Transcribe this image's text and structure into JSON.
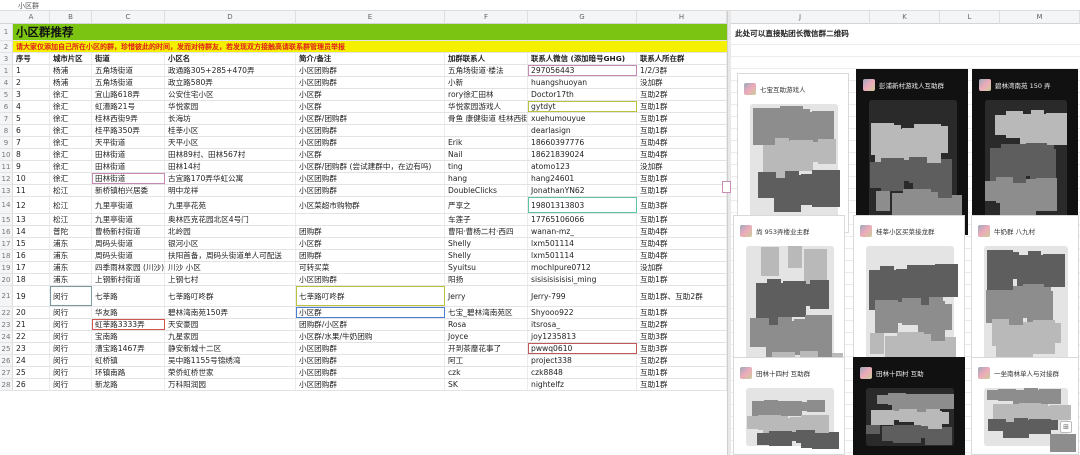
{
  "formula_bar": {
    "cell_text": "小区群"
  },
  "columns": [
    {
      "letter": "A"
    },
    {
      "letter": "B"
    },
    {
      "letter": "C"
    },
    {
      "letter": "D"
    },
    {
      "letter": "E"
    },
    {
      "letter": "F"
    },
    {
      "letter": "G"
    },
    {
      "letter": "H"
    },
    {
      "letter": "I"
    },
    {
      "letter": "J"
    },
    {
      "letter": "K"
    },
    {
      "letter": "L"
    },
    {
      "letter": "M"
    }
  ],
  "sheet": {
    "title": "小区群推荐",
    "notice": "请大家仅添加自己所在小区的群，珍惜彼此的时间，发而对待群友，若发现双方接触高请联系群管理员举报",
    "headers": [
      "序号",
      "城市片区",
      "街道",
      "小区名",
      "简介/备注",
      "加群联系人",
      "联系人微信 (添加暗号GHG)",
      "联系人所在群"
    ],
    "rows": [
      {
        "n": "1",
        "cells": [
          "1",
          "杨浦",
          "五角场街道",
          "政通路305+285+470弄",
          "小区团购群",
          "五角场街道·楼法",
          "297056443",
          "1/2/3群"
        ]
      },
      {
        "n": "4",
        "cells": [
          "2",
          "杨浦",
          "五角场街道",
          "政立路580弄",
          "小区团购群",
          "小新",
          "huangshuoyan",
          "没加群"
        ]
      },
      {
        "n": "5",
        "cells": [
          "3",
          "徐汇",
          "宜山路618弄",
          "公安住宅小区",
          "小区群",
          "rory徐汇田林",
          "Doctor17th",
          "互助2群"
        ]
      },
      {
        "n": "6",
        "cells": [
          "4",
          "徐汇",
          "虹漕路21号",
          "华悦家园",
          "小区群",
          "华悦家园游戏人",
          "gytdyt",
          "互助1群"
        ]
      },
      {
        "n": "7",
        "cells": [
          "5",
          "徐汇",
          "桂林西街9弄",
          "长海坊",
          "小区群/团购群",
          "骨鱼 康健街道 桂林西街",
          "xuehumouyue",
          "互助1群"
        ]
      },
      {
        "n": "8",
        "cells": [
          "6",
          "徐汇",
          "桂平路350弄",
          "桂莘小区",
          "小区团购群",
          "",
          "dearlasign",
          "互助1群"
        ]
      },
      {
        "n": "9",
        "cells": [
          "7",
          "徐汇",
          "天平街道",
          "天平小区",
          "小区团购群",
          "Erik",
          "18660397776",
          "互助4群"
        ]
      },
      {
        "n": "10",
        "cells": [
          "8",
          "徐汇",
          "田林街道",
          "田林89村、田林567村",
          "小区群",
          "Nail",
          "18621839024",
          "互助4群"
        ]
      },
      {
        "n": "11",
        "cells": [
          "9",
          "徐汇",
          "田林街道",
          "田林14村",
          "小区群/团购群 (尝试建群中，在边有吗)",
          "ting",
          "atomo123",
          "没加群"
        ]
      },
      {
        "n": "12",
        "cells": [
          "10",
          "徐汇",
          "田林街道",
          "古宜路170弄华虹公寓",
          "小区团购群",
          "hang",
          "hang24601",
          "互助1群"
        ]
      },
      {
        "n": "13",
        "cells": [
          "11",
          "松江",
          "新桥镇柏兴居委",
          "明中龙祥",
          "小区团购群",
          "DoubleClicks",
          "JonathanYN62",
          "互助1群"
        ]
      },
      {
        "n": "14",
        "cells": [
          "12",
          "松江",
          "九里亭街道",
          "九里亭花苑",
          "小区菜超市购物群",
          "严享之",
          "19801313803",
          "互助3群"
        ]
      },
      {
        "n": "15",
        "cells": [
          "13",
          "松江",
          "九里亭街道",
          "奥林匹克花园北区4号门",
          "",
          "车莲子",
          "17765106066",
          "互助1群"
        ]
      },
      {
        "n": "16",
        "cells": [
          "14",
          "普陀",
          "曹杨新村街道",
          "北岭园",
          "团购群",
          "曹阳·曹杨二村·西四",
          "wanan-mz_",
          "互助4群"
        ]
      },
      {
        "n": "17",
        "cells": [
          "15",
          "浦东",
          "周码头街道",
          "银河小区",
          "小区群",
          "Shelly",
          "lxm501114",
          "互助4群"
        ]
      },
      {
        "n": "18",
        "cells": [
          "16",
          "浦东",
          "周码头街道",
          "扶阳首备，周码头街道单人可配送",
          "团购群",
          "Shelly",
          "lxm501114",
          "互助4群"
        ]
      },
      {
        "n": "19",
        "cells": [
          "17",
          "浦东",
          "四季雨林家园 (川沙)",
          "川沙 小区",
          "可转买菜",
          "Syuitsu",
          "mochlpure0712",
          "没加群"
        ]
      },
      {
        "n": "20",
        "cells": [
          "18",
          "浦东",
          "上钢新村街道",
          "上钢七村",
          "小区团购群",
          "阳扬",
          "sisisisisisisi_ming",
          "互助1群"
        ]
      },
      {
        "n": "21",
        "cells": [
          "19",
          "闵行",
          "七莘路",
          "七莘路叮咚群",
          "七莘路叮咚群",
          "Jerry",
          "Jerry-799",
          "互助1群、互助2群"
        ]
      },
      {
        "n": "22",
        "cells": [
          "20",
          "闵行",
          "华友路",
          "碧林湾南苑150弄",
          "小区群",
          "七宝_碧林湾南苑区",
          "Shyooo922",
          "互助1群"
        ]
      },
      {
        "n": "23",
        "cells": [
          "21",
          "闵行",
          "虹莘路3333弄",
          "天安豪园",
          "团购群/小区群",
          "Rosa",
          "itsrosa_",
          "互助2群"
        ]
      },
      {
        "n": "24",
        "cells": [
          "22",
          "闵行",
          "宝南路",
          "九星家园",
          "小区群/水果/牛奶团购",
          "Joyce",
          "joy1235813",
          "互助3群"
        ]
      },
      {
        "n": "25",
        "cells": [
          "23",
          "闵行",
          "漕宝路1467弄",
          "静安新城十二区",
          "小区团购群",
          "开到茶蘼花事了",
          "pwwq0610",
          "互助3群"
        ]
      },
      {
        "n": "26",
        "cells": [
          "24",
          "闵行",
          "虹桥镇",
          "吴中路1155号锦绣湾",
          "小区团购群",
          "阿工",
          "project338",
          "互助2群"
        ]
      },
      {
        "n": "27",
        "cells": [
          "25",
          "闵行",
          "环镇南路",
          "荣侨虹桥世家",
          "小区团购群",
          "czk",
          "czk8848",
          "互助1群"
        ]
      },
      {
        "n": "28",
        "cells": [
          "26",
          "闵行",
          "新龙路",
          "万科阳润园",
          "小区团购群",
          "SK",
          "nightelfz",
          "互助1群"
        ]
      }
    ]
  },
  "right_pane": {
    "note": "此处可以直接贴团长微信群二维码",
    "qr_cards": [
      {
        "name": "七宝互助游戏人"
      },
      {
        "name": "彭浦新村游戏人互助群"
      },
      {
        "name": "碧林湾南苑 150 弄"
      },
      {
        "name": "尚 953弄楼业主群"
      },
      {
        "name": "桂莘小区买菜接龙群"
      },
      {
        "name": "牛奶群 八九村"
      },
      {
        "name": "田林十四村 互助群"
      },
      {
        "name": "田林十四村 互助"
      },
      {
        "name": "一坐南林单人与对接群"
      }
    ]
  },
  "scroll_button": "⊞"
}
